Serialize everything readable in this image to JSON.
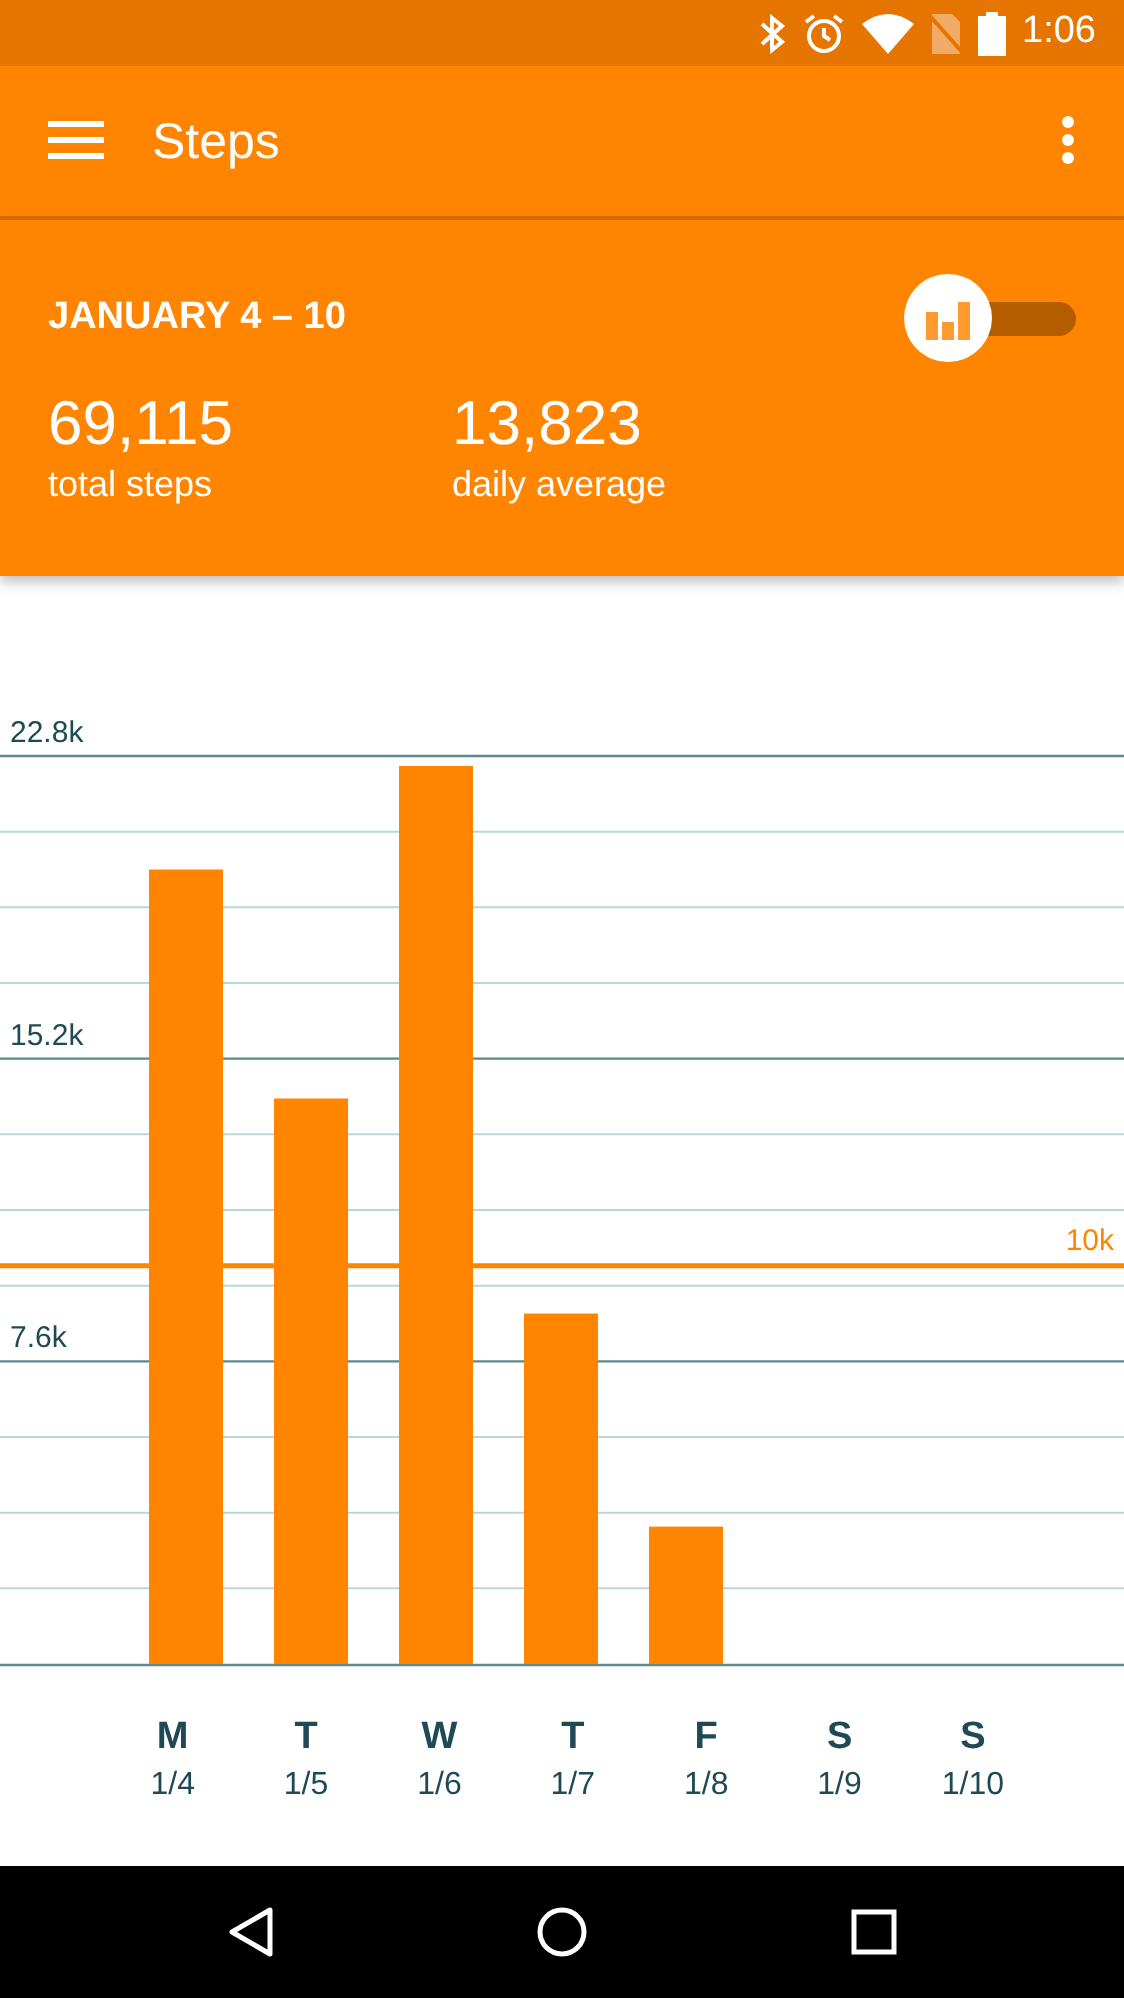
{
  "status_bar": {
    "time": "1:06"
  },
  "app_bar": {
    "title": "Steps"
  },
  "summary": {
    "range": "JANUARY 4 – 10",
    "view_toggle": {
      "checked": false
    },
    "stats": [
      {
        "value": "69,115",
        "label": "total steps"
      },
      {
        "value": "13,823",
        "label": "daily average"
      }
    ]
  },
  "chart": {
    "chart_data": {
      "type": "bar",
      "categories": [
        "M",
        "T",
        "W",
        "T",
        "F",
        "S",
        "S"
      ],
      "series": [
        {
          "color": "#ff8500",
          "values": [
            19.95,
            14.2,
            22.55,
            8.8,
            3.45,
            null,
            null
          ]
        }
      ],
      "ylim": [
        0,
        22.8
      ],
      "yticks": [
        {
          "value": 7.6,
          "label": "7.6k"
        },
        {
          "value": 15.2,
          "label": "15.2k"
        },
        {
          "value": 22.8,
          "label": "22.8k"
        }
      ],
      "ref_lines": [
        {
          "axis": "y",
          "value": 10,
          "label": "10k"
        }
      ]
    },
    "dates": [
      "1/4",
      "1/5",
      "1/6",
      "1/7",
      "1/8",
      "1/9",
      "1/10"
    ]
  }
}
